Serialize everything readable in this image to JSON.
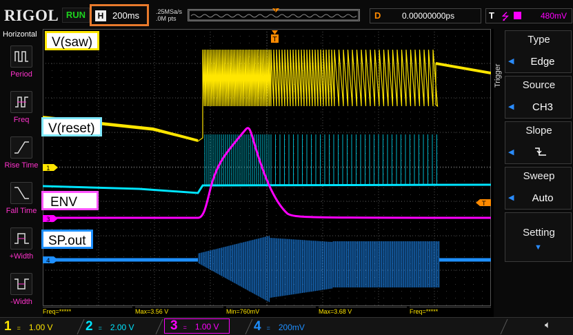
{
  "header": {
    "brand": "RIGOL",
    "run_state": "RUN",
    "timebase_prefix": "H",
    "timebase": "200ms",
    "sample_rate": ".25MSa/s",
    "memory_depth": ".0M pts",
    "delay_prefix": "D",
    "delay": "0.00000000ps",
    "trigger_prefix": "T",
    "trigger_level": "480mV"
  },
  "left_menu": {
    "title": "Horizontal",
    "items": [
      {
        "label": "Period",
        "icon": "period-icon"
      },
      {
        "label": "Freq",
        "icon": "freq-icon"
      },
      {
        "label": "Rise Time",
        "icon": "rise-time-icon"
      },
      {
        "label": "Fall Time",
        "icon": "fall-time-icon"
      },
      {
        "label": "+Width",
        "icon": "positive-width-icon"
      },
      {
        "label": "-Width",
        "icon": "negative-width-icon"
      }
    ]
  },
  "right_menu": {
    "tab": "Trigger",
    "items": [
      {
        "title": "Type",
        "value": "Edge"
      },
      {
        "title": "Source",
        "value": "CH3"
      },
      {
        "title": "Slope",
        "value": ""
      },
      {
        "title": "Sweep",
        "value": "Auto"
      },
      {
        "title": "Setting",
        "value": ""
      }
    ]
  },
  "annotations": {
    "saw": "V(saw)",
    "reset": "V(reset)",
    "env": "ENV",
    "spout": "SP.out"
  },
  "measurements": [
    "Freq=*****",
    "Max=3.56 V",
    "Min=760mV",
    "Max=3.68 V",
    "Freq=*****"
  ],
  "channels": [
    {
      "num": "1",
      "scale": "1.00 V",
      "color": "#ffe600"
    },
    {
      "num": "2",
      "scale": "2.00 V",
      "color": "#00e5ff"
    },
    {
      "num": "3",
      "scale": "1.00 V",
      "color": "#ff00ff"
    },
    {
      "num": "4",
      "scale": "200mV",
      "color": "#1e8fff"
    }
  ],
  "colors": {
    "ch1": "#ffe600",
    "ch2": "#00e5ff",
    "ch3": "#ff00ff",
    "ch4": "#1e8fff",
    "accent": "#e87a2c",
    "trigger": "#ff8a00"
  }
}
